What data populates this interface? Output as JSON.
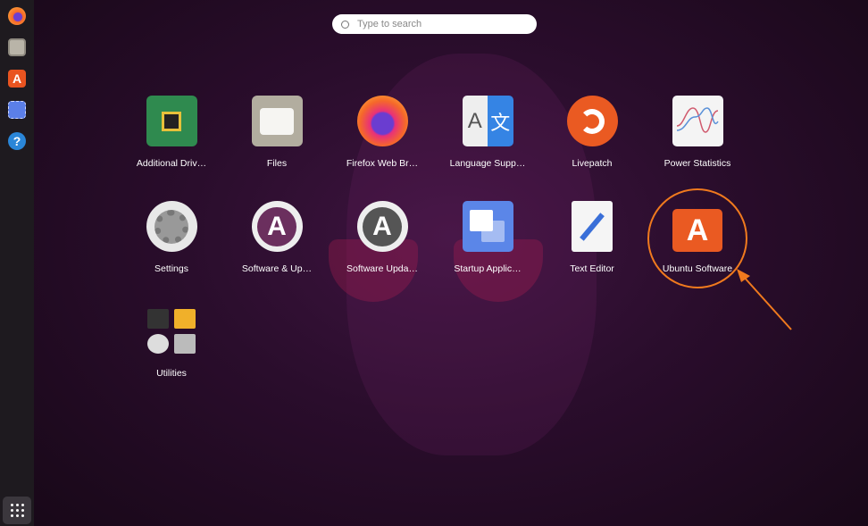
{
  "search": {
    "placeholder": "Type to search"
  },
  "dock": [
    {
      "name": "firefox-icon",
      "color": "#f5682a"
    },
    {
      "name": "files-icon",
      "color": "#b9b4a8"
    },
    {
      "name": "ubuntu-software-icon",
      "color": "#e95420"
    },
    {
      "name": "screenshot-icon",
      "color": "#5b7fe8"
    },
    {
      "name": "help-icon",
      "color": "#2a86d8"
    }
  ],
  "apps": [
    {
      "label": "Additional Driv…"
    },
    {
      "label": "Files"
    },
    {
      "label": "Firefox Web Br…"
    },
    {
      "label": "Language Supp…"
    },
    {
      "label": "Livepatch"
    },
    {
      "label": "Power Statistics"
    },
    {
      "label": "Settings"
    },
    {
      "label": "Software & Up…"
    },
    {
      "label": "Software Upda…"
    },
    {
      "label": "Startup Applic…"
    },
    {
      "label": "Text Editor"
    },
    {
      "label": "Ubuntu Software"
    },
    {
      "label": "Utilities"
    }
  ],
  "lang_icon": {
    "left": "A",
    "right": "文"
  },
  "accent": "#f07a1e"
}
